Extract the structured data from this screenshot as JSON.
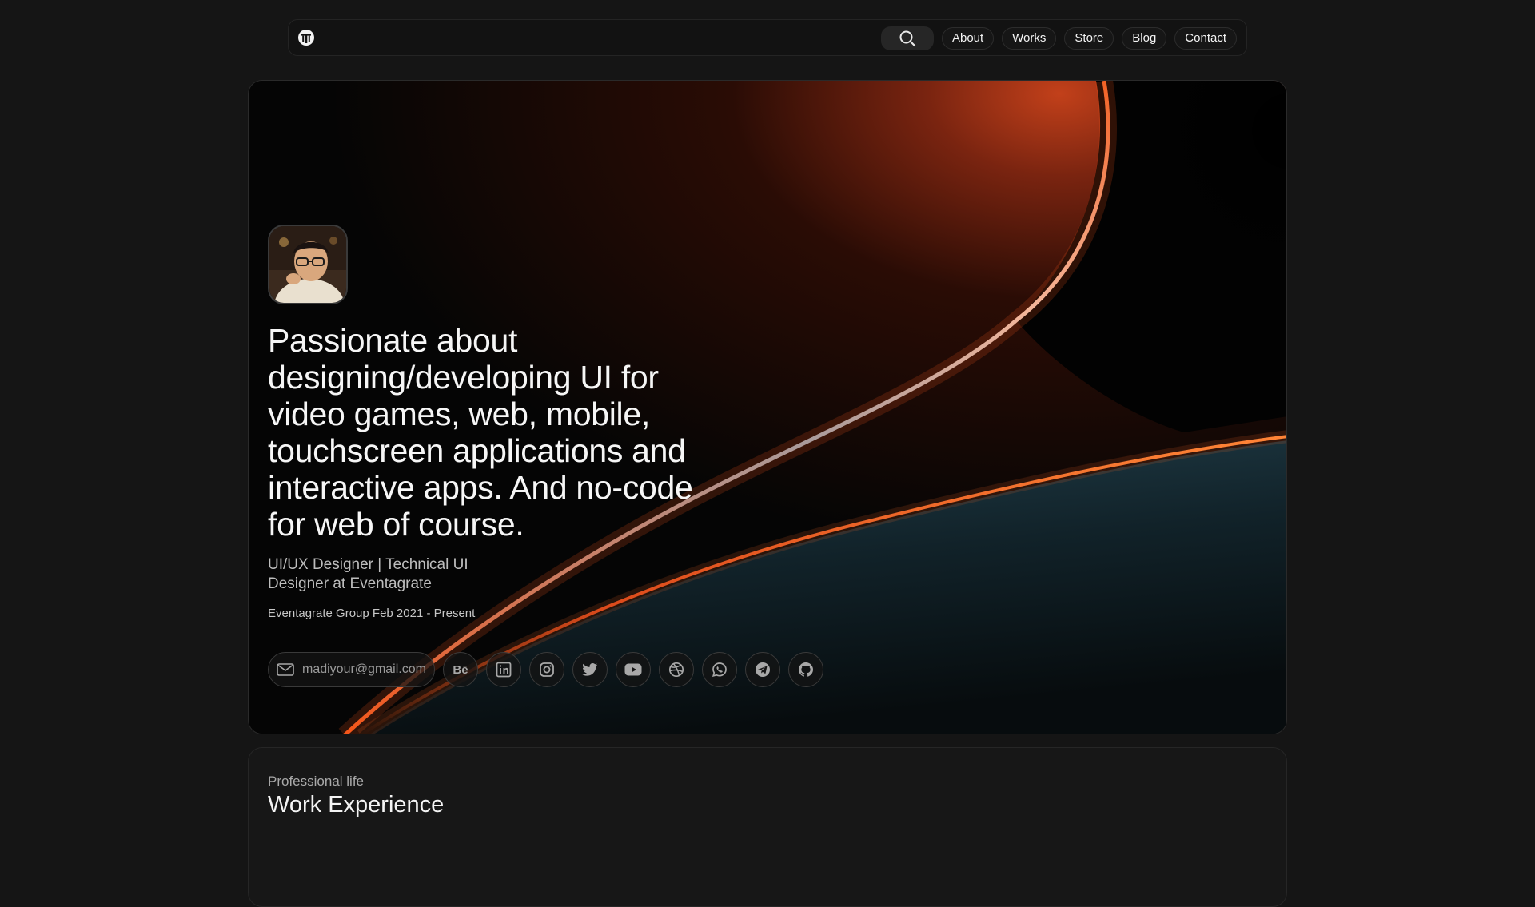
{
  "nav": {
    "logo_icon": "t-logo-icon",
    "search_icon": "search-icon",
    "links": [
      "About",
      "Works",
      "Store",
      "Blog",
      "Contact"
    ]
  },
  "hero": {
    "headline": "Passionate about designing/developing UI for video games, web, mobile, touchscreen applications and interactive apps. And no-code for web of course.",
    "role": "UI/UX Designer | Technical UI Designer at Eventagrate",
    "company": "Eventagrate Group Feb 2021 - Present",
    "email": "madiyour@gmail.com",
    "social_icons": [
      "behance-icon",
      "linkedin-icon",
      "instagram-icon",
      "twitter-icon",
      "youtube-icon",
      "dribbble-icon",
      "whatsapp-icon",
      "telegram-icon",
      "github-icon"
    ],
    "behance_text": "Bē"
  },
  "work": {
    "kicker": "Professional life",
    "title": "Work Experience"
  },
  "colors": {
    "background": "#151515",
    "accent_orange": "#ff5a1a",
    "teal": "#1d3a45"
  }
}
